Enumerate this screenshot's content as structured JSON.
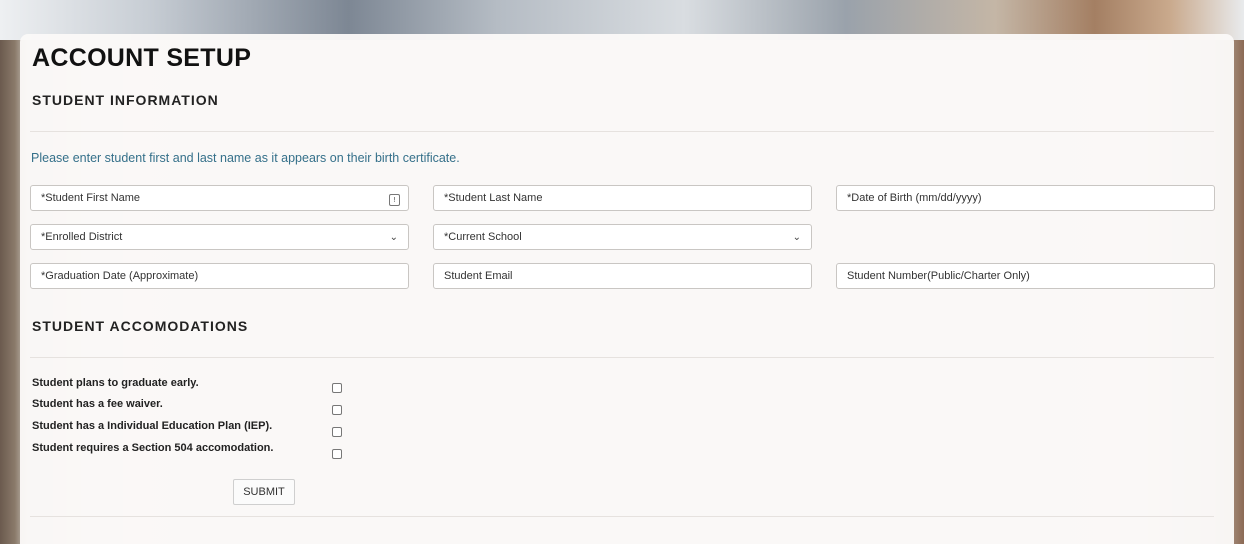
{
  "page": {
    "title": "ACCOUNT SETUP"
  },
  "student_info": {
    "heading": "STUDENT INFORMATION",
    "note": "Please enter student first and last name as it appears on their birth certificate.",
    "first_name": {
      "placeholder": "*Student First Name"
    },
    "last_name": {
      "placeholder": "*Student Last Name"
    },
    "dob": {
      "placeholder": "*Date of Birth (mm/dd/yyyy)"
    },
    "district": {
      "selected": "*Enrolled District"
    },
    "school": {
      "selected": "*Current School"
    },
    "graduation": {
      "placeholder": "*Graduation Date (Approximate)"
    },
    "email": {
      "placeholder": "Student Email"
    },
    "student_number": {
      "placeholder": "Student Number(Public/Charter Only)"
    },
    "first_name_icon": "contact-card-icon"
  },
  "accommodations": {
    "heading": "STUDENT ACCOMODATIONS",
    "items": [
      {
        "label": "Student plans to graduate early.",
        "checked": false
      },
      {
        "label": "Student has a fee waiver.",
        "checked": false
      },
      {
        "label": "Student has a Individual Education Plan (IEP).",
        "checked": false
      },
      {
        "label": "Student requires a Section 504 accomodation.",
        "checked": false
      }
    ]
  },
  "submit_label": "SUBMIT"
}
